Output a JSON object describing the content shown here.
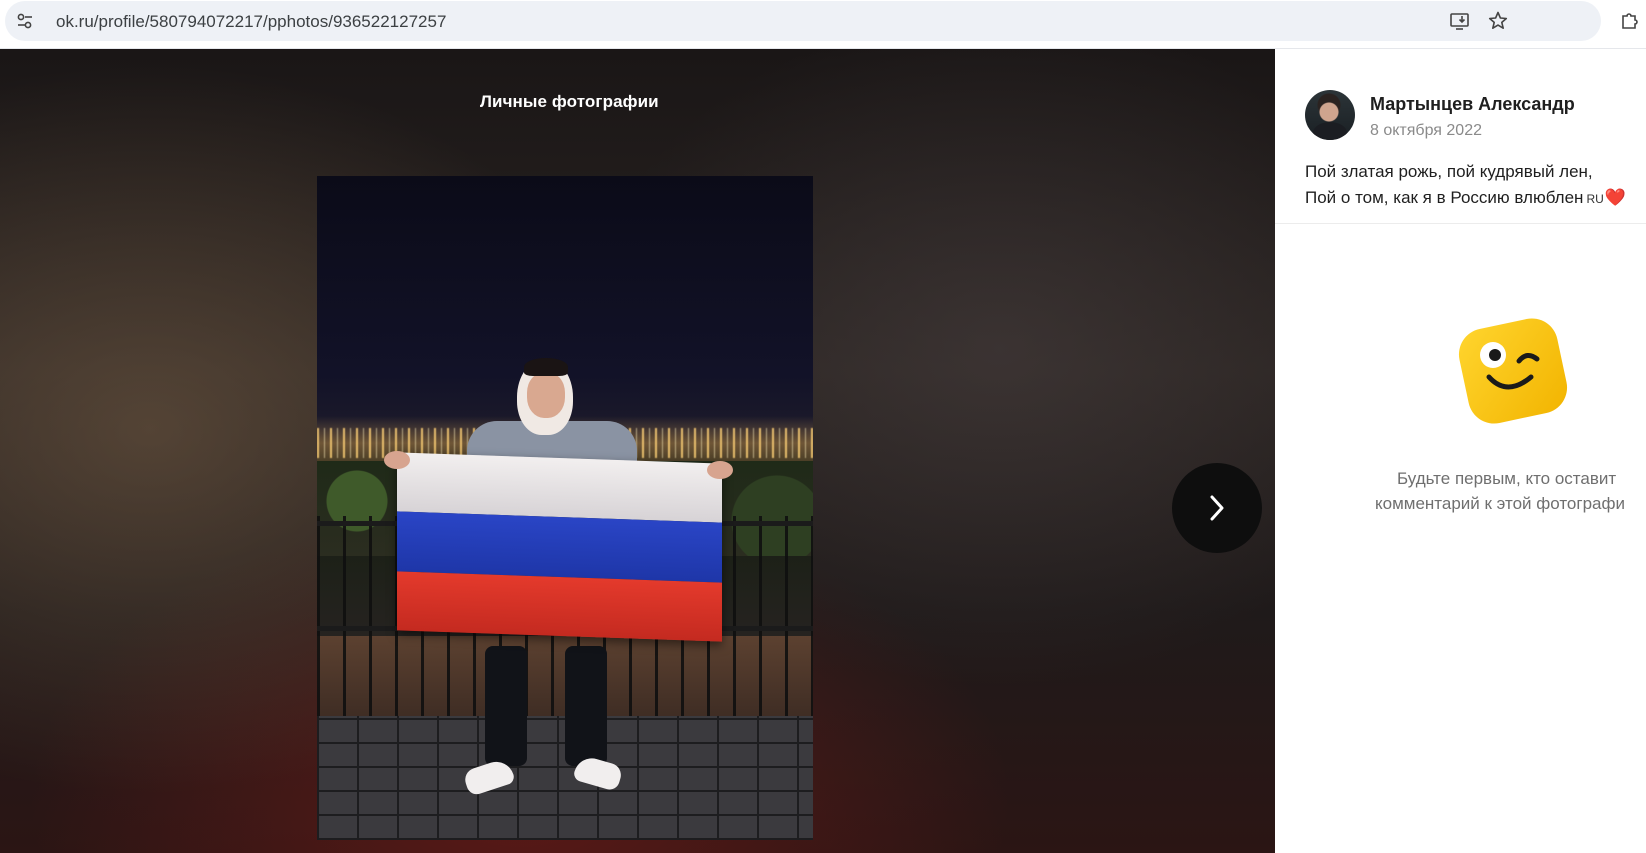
{
  "browser": {
    "url": "ok.ru/profile/580794072217/pphotos/936522127257",
    "icons": [
      "site-info-icon",
      "install-app-icon",
      "bookmark-star-icon",
      "extensions-icon"
    ]
  },
  "viewer": {
    "album_title": "Личные фотографии",
    "photo_alt": "Фотография",
    "next_icon": "chevron-right-icon"
  },
  "post": {
    "author_name": "Мартынцев Александр",
    "date": "8 октября 2022",
    "caption_line1": "Пой златая рожь, пой кудрявый лен,",
    "caption_line2": "Пой о том, как я в Россию влюблен",
    "caption_flag": "RU",
    "caption_heart": "❤️"
  },
  "comments": {
    "empty_line1": "Будьте первым, кто оставит",
    "empty_line2": "комментарий к этой фотографи"
  },
  "colors": {
    "accent_yellow": "#f7c400",
    "heart_red": "#e3242b"
  }
}
